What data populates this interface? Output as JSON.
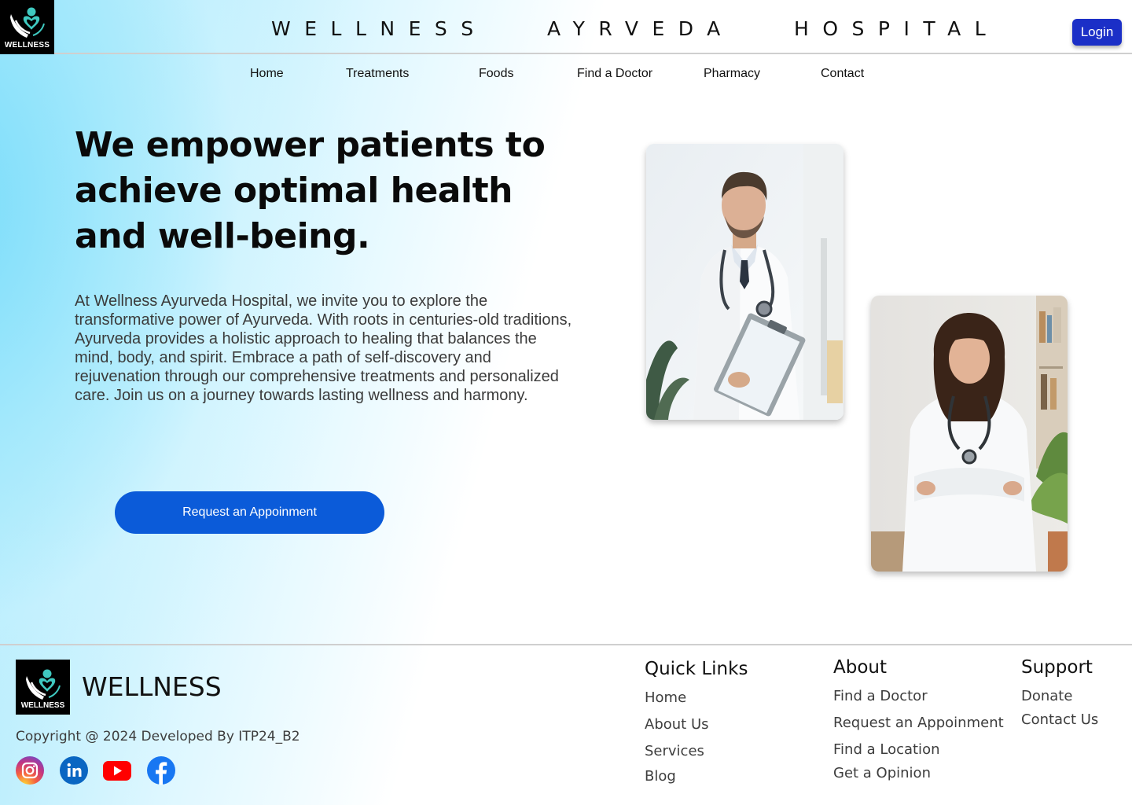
{
  "header": {
    "logo_text": "WELLNESS",
    "site_title": "WELLNESS   AYRVEDA   HOSPITAL",
    "login_label": "Login"
  },
  "nav": {
    "items": [
      {
        "label": "Home"
      },
      {
        "label": "Treatments"
      },
      {
        "label": "Foods"
      },
      {
        "label": "Find a Doctor"
      },
      {
        "label": "Pharmacy"
      },
      {
        "label": "Contact"
      }
    ]
  },
  "hero": {
    "title": "We empower patients to achieve optimal health and well-being.",
    "description": "At Wellness Ayurveda Hospital, we invite you to explore the transformative power of Ayurveda. With roots in centuries-old traditions, Ayurveda provides a holistic approach to healing that balances the mind, body, and spirit. Embrace a path of self-discovery and rejuvenation through our comprehensive treatments and personalized care. Join us on a journey towards lasting wellness and harmony.",
    "cta_label": "Request an Appoinment"
  },
  "footer": {
    "logo_text": "WELLNESS",
    "brand": "WELLNESS",
    "copyright": "Copyright @ 2024 Developed By ITP24_B2",
    "social_icons": [
      "instagram-icon",
      "linkedin-icon",
      "youtube-icon",
      "facebook-icon"
    ],
    "quick_links": {
      "title": "Quick Links",
      "links": [
        "Home",
        "About Us",
        "Services",
        "Blog"
      ]
    },
    "about": {
      "title": "About",
      "links": [
        "Find a Doctor",
        "Request an Appoinment",
        "Find a Location",
        "Get a Opinion"
      ]
    },
    "support": {
      "title": "Support",
      "links": [
        "Donate",
        "Contact Us"
      ]
    }
  },
  "colors": {
    "login_button": "#1b2fc7",
    "cta_button": "#0b5bd9",
    "logo_teal": "#3fc9c0",
    "gradient_cyan": "#7fe0fa"
  }
}
